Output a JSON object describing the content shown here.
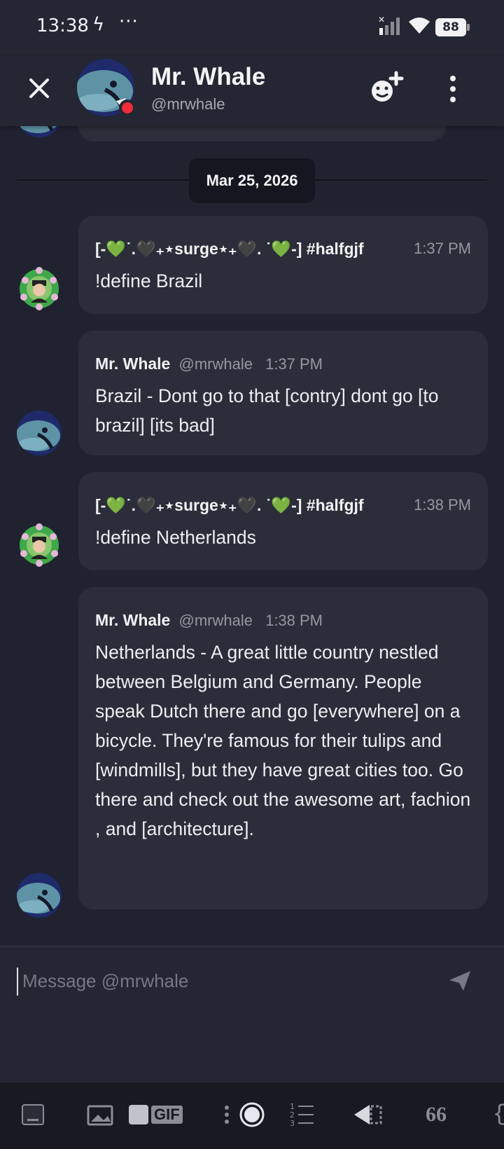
{
  "status_bar": {
    "time": "13:38",
    "battery": "88"
  },
  "header": {
    "name": "Mr. Whale",
    "handle": "@mrwhale"
  },
  "date_divider": "Mar 25, 2026",
  "messages": [
    {
      "author": "[-💚˙.🖤₊⋆surge⋆₊🖤. ˙💚-] #halfgjf",
      "time": "1:37 PM",
      "text": "!define Brazil"
    },
    {
      "author": "Mr. Whale",
      "handle": "@mrwhale",
      "time": "1:37 PM",
      "text": "Brazil - Dont go to that [contry] dont go [to brazil] [its bad]"
    },
    {
      "author": "[-💚˙.🖤₊⋆surge⋆₊🖤. ˙💚-] #halfgjf",
      "time": "1:38 PM",
      "text": "!define Netherlands"
    },
    {
      "author": "Mr. Whale",
      "handle": "@mrwhale",
      "time": "1:38 PM",
      "text": "Netherlands - A great little country nestled between Belgium and Germany. People speak Dutch there and go [everywhere] on a bicycle. They're famous for their tulips and [windmills], but they have great cities too. Go there and check out the awesome art, fachion , and [architecture]."
    }
  ],
  "composer": {
    "placeholder": "Message @mrwhale"
  },
  "toolbar": {
    "gif_label": "GIF",
    "quote_label": "66",
    "brace_label": "{"
  },
  "colors": {
    "background": "#202230",
    "bubble": "#2b2d3a",
    "status_dot": "#ed2c3a"
  }
}
